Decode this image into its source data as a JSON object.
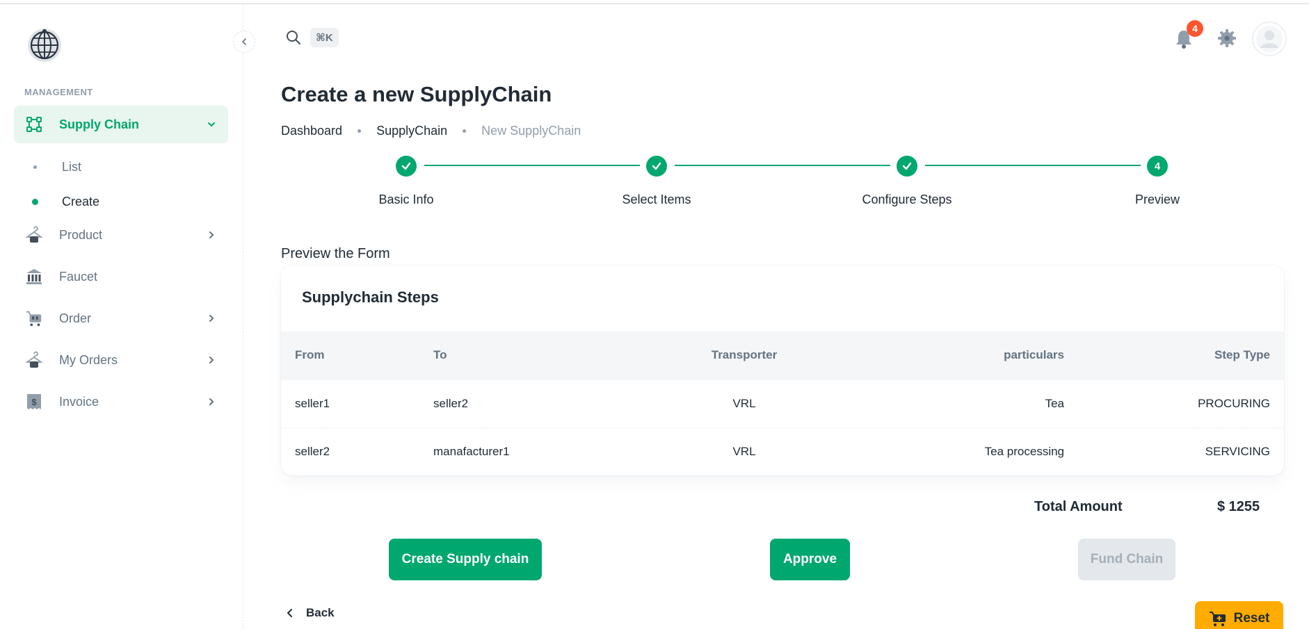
{
  "sidebar": {
    "section_label": "MANAGEMENT",
    "items": [
      {
        "label": "Supply Chain",
        "icon": "supply-chain-icon"
      },
      {
        "label": "Product",
        "icon": "hanger-icon"
      },
      {
        "label": "Faucet",
        "icon": "bank-icon"
      },
      {
        "label": "Order",
        "icon": "cart-icon"
      },
      {
        "label": "My Orders",
        "icon": "hanger-icon"
      },
      {
        "label": "Invoice",
        "icon": "invoice-icon"
      }
    ],
    "sub_items": [
      {
        "label": "List"
      },
      {
        "label": "Create"
      }
    ]
  },
  "header": {
    "search_shortcut": "⌘K",
    "notification_count": "4"
  },
  "page": {
    "title": "Create a new SupplyChain",
    "breadcrumbs": [
      "Dashboard",
      "SupplyChain",
      "New SupplyChain"
    ]
  },
  "stepper": {
    "steps": [
      {
        "label": "Basic Info",
        "status": "completed"
      },
      {
        "label": "Select Items",
        "status": "completed"
      },
      {
        "label": "Configure Steps",
        "status": "completed"
      },
      {
        "label": "Preview",
        "status": "active",
        "number": "4"
      }
    ]
  },
  "preview": {
    "label": "Preview the Form",
    "card_title": "Supplychain Steps",
    "columns": [
      "From",
      "To",
      "Transporter",
      "particulars",
      "Step Type"
    ],
    "rows": [
      [
        "seller1",
        "seller2",
        "VRL",
        "Tea",
        "PROCURING"
      ],
      [
        "seller2",
        "manafacturer1",
        "VRL",
        "Tea processing",
        "SERVICING"
      ]
    ],
    "total_label": "Total Amount",
    "total_value": "$ 1255"
  },
  "actions": {
    "create": "Create Supply chain",
    "approve": "Approve",
    "fund": "Fund Chain",
    "back": "Back",
    "reset": "Reset"
  },
  "colors": {
    "primary": "#00a76f",
    "badge": "#ff5630",
    "warning": "#ffab00"
  }
}
